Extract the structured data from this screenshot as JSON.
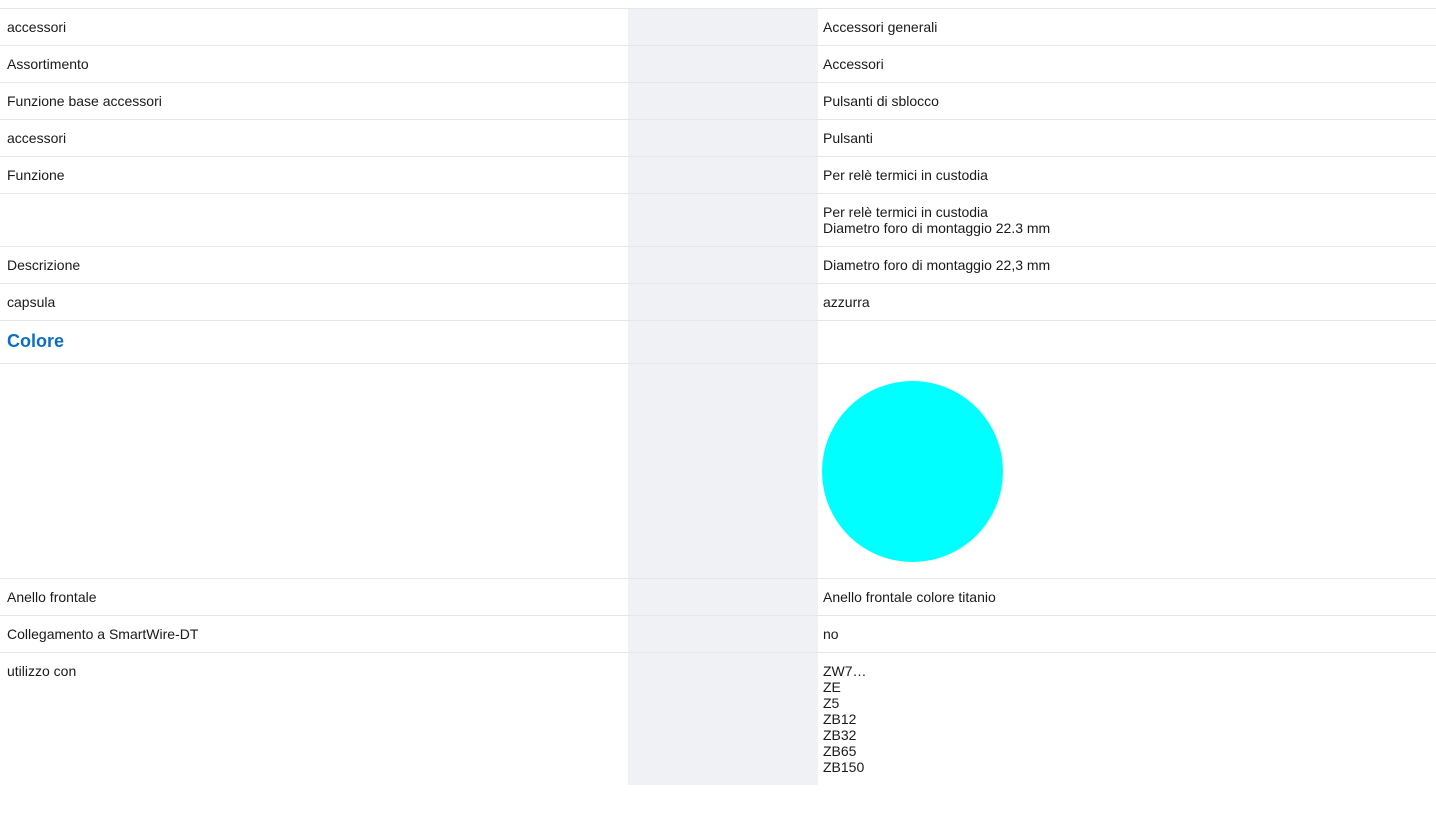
{
  "top_heading_fragment": "",
  "rows": [
    {
      "label": "accessori",
      "value": "Accessori generali"
    },
    {
      "label": "Assortimento",
      "value": "Accessori"
    },
    {
      "label": "Funzione base accessori",
      "value": "Pulsanti di sblocco"
    },
    {
      "label": "accessori",
      "value": "Pulsanti"
    },
    {
      "label": "Funzione",
      "value": "Per relè termici in custodia"
    },
    {
      "label": "",
      "lines": [
        "Per relè termici in custodia",
        "Diametro foro di montaggio 22.3 mm"
      ]
    },
    {
      "label": "Descrizione",
      "value": "Diametro foro di montaggio 22,3 mm"
    },
    {
      "label": "capsula",
      "value": "azzurra"
    },
    {
      "label": "Anello frontale",
      "value": "Anello frontale colore titanio"
    },
    {
      "label": "Collegamento a SmartWire-DT",
      "value": "no"
    },
    {
      "label": "utilizzo con",
      "lines": [
        "ZW7…",
        "ZE",
        "Z5",
        "ZB12",
        "ZB32",
        "ZB65",
        "ZB150"
      ]
    }
  ],
  "color_section": {
    "title": "Colore",
    "swatch_color": "#00ffff"
  },
  "colors": {
    "accent": "#0a6fc2",
    "spacer_column": "#f0f1f5",
    "row_border": "#e4e6ea"
  }
}
